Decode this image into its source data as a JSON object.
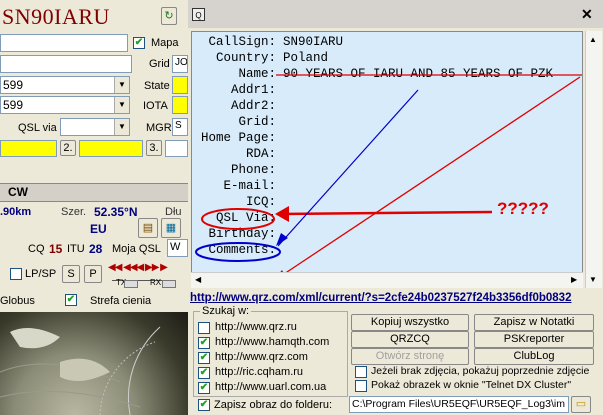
{
  "left": {
    "callsign": "SN90IARU",
    "mapa_label": "Mapa",
    "grid_label": "Grid",
    "grid_value": "JO",
    "state_label": "State",
    "rst_sent": "599",
    "rst_rcvd": "599",
    "iota_label": "IOTA",
    "qsl_via_label": "QSL via",
    "mgr_label": "MGR",
    "mgr_value": "S",
    "btn2": "2.",
    "btn3": "3.",
    "mode": "CW",
    "distance": ".90km",
    "lat_label": "Szer.",
    "lat_value": "52.35°N",
    "lon_label": "Dłu",
    "continent": "EU",
    "cq_label": "CQ",
    "cq_value": "15",
    "itu_label": "ITU",
    "itu_value": "28",
    "moja_qsl_label": "Moja QSL",
    "moja_qsl_value": "W",
    "lp_sp_label": "LP/SP",
    "s_btn": "S",
    "p_btn": "P",
    "tx_label": "TX",
    "rx_label": "RX",
    "globus_label": "Globus",
    "strefa_label": "Strefa cienia"
  },
  "window": {
    "icon_text": "Q",
    "close": "✕",
    "fields": [
      {
        "label": "CallSign:",
        "value": "SN90IARU"
      },
      {
        "label": "Country:",
        "value": "Poland"
      },
      {
        "label": "Name:",
        "value": "90 YEARS OF IARU AND 85 YEARS OF PZK"
      },
      {
        "label": "Addr1:",
        "value": ""
      },
      {
        "label": "Addr2:",
        "value": ""
      },
      {
        "label": "Grid:",
        "value": ""
      },
      {
        "label": "Home Page:",
        "value": ""
      },
      {
        "label": "RDA:",
        "value": ""
      },
      {
        "label": "Phone:",
        "value": ""
      },
      {
        "label": "E-mail:",
        "value": ""
      },
      {
        "label": "ICQ:",
        "value": ""
      },
      {
        "label": "QSL Via:",
        "value": ""
      },
      {
        "label": "Birthday:",
        "value": ""
      },
      {
        "label": "Comments:",
        "value": ""
      }
    ],
    "annotation": "?????",
    "url": "http://www.qrz.com/xml/current/?s=2cfe24b0237527f24b3356df0b0832",
    "search_group_title": "Szukaj w:",
    "search_sites": [
      {
        "label": "http://www.qrz.ru",
        "checked": false
      },
      {
        "label": "http://www.hamqth.com",
        "checked": true
      },
      {
        "label": "http://www.qrz.com",
        "checked": true
      },
      {
        "label": "http://ric.cqham.ru",
        "checked": true
      },
      {
        "label": "http://www.uarl.com.ua",
        "checked": true
      }
    ],
    "buttons": {
      "copy_all": "Kopiuj wszystko",
      "save_notes": "Zapisz w Notatki",
      "qrzcq": "QRZCQ",
      "pskreporter": "PSKreporter",
      "open_page": "Otwórz stronę",
      "clublog": "ClubLog"
    },
    "opt1": "Jeżeli brak zdjęcia, pokażuj poprzednie zdjęcie",
    "opt2": "Pokaż obrazek w oknie \"Telnet DX Cluster\"",
    "save_image_label": "Zapisz obraz do folderu:",
    "folder_path": "C:\\Program Files\\UR5EQF\\UR5EQF_Log3\\im"
  }
}
